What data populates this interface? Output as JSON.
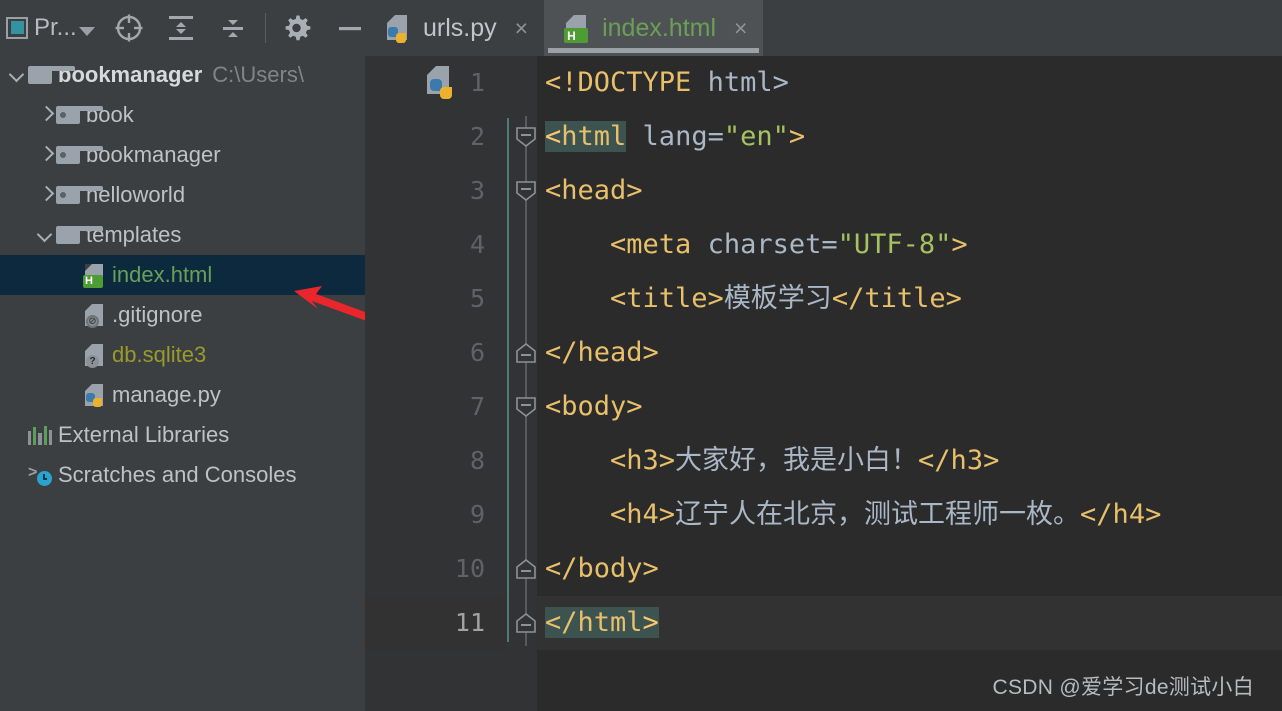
{
  "window": {
    "top_edge_color": "#2e3032"
  },
  "project_panel": {
    "title": "Pr...",
    "title_icon": "project-window-icon",
    "toolbar_buttons": [
      {
        "name": "select-opened-file-icon",
        "tooltip": "Select Opened File"
      },
      {
        "name": "expand-all-icon",
        "tooltip": "Expand All"
      },
      {
        "name": "collapse-all-icon",
        "tooltip": "Collapse All"
      },
      {
        "name": "settings-gear-icon",
        "tooltip": "Settings"
      },
      {
        "name": "hide-panel-icon",
        "tooltip": "Hide"
      }
    ],
    "tree": [
      {
        "label": "bookmanager",
        "path_hint": "C:\\Users\\",
        "icon": "folder-icon",
        "expander": "down",
        "indent": 0,
        "style": "bold",
        "selected": false
      },
      {
        "label": "book",
        "path_hint": "",
        "icon": "folder-module-icon",
        "expander": "right",
        "indent": 1,
        "style": "normal",
        "selected": false
      },
      {
        "label": "bookmanager",
        "path_hint": "",
        "icon": "folder-module-icon",
        "expander": "right",
        "indent": 1,
        "style": "normal",
        "selected": false
      },
      {
        "label": "helloworld",
        "path_hint": "",
        "icon": "folder-module-icon",
        "expander": "right",
        "indent": 1,
        "style": "normal",
        "selected": false
      },
      {
        "label": "templates",
        "path_hint": "",
        "icon": "folder-icon",
        "expander": "down",
        "indent": 1,
        "style": "normal",
        "selected": false
      },
      {
        "label": "index.html",
        "path_hint": "",
        "icon": "html-file-icon",
        "expander": "none",
        "indent": 2,
        "style": "green",
        "selected": true
      },
      {
        "label": ".gitignore",
        "path_hint": "",
        "icon": "gitignore-file-icon",
        "expander": "none",
        "indent": 2,
        "style": "normal",
        "selected": false
      },
      {
        "label": "db.sqlite3",
        "path_hint": "",
        "icon": "unknown-file-icon",
        "expander": "none",
        "indent": 2,
        "style": "olive",
        "selected": false
      },
      {
        "label": "manage.py",
        "path_hint": "",
        "icon": "python-file-icon",
        "expander": "none",
        "indent": 2,
        "style": "normal",
        "selected": false
      },
      {
        "label": "External Libraries",
        "path_hint": "",
        "icon": "external-libraries-icon",
        "expander": "none",
        "indent": 0,
        "style": "normal",
        "selected": false
      },
      {
        "label": "Scratches and Consoles",
        "path_hint": "",
        "icon": "scratches-consoles-icon",
        "expander": "none",
        "indent": 0,
        "style": "normal",
        "selected": false
      }
    ],
    "annotation": {
      "name": "red-arrow-annotation",
      "color": "#e8262b",
      "points_at": "index.html"
    }
  },
  "editor": {
    "tabs": [
      {
        "title": "urls.py",
        "icon": "python-file-icon",
        "active": false,
        "close_glyph": "×"
      },
      {
        "title": "index.html",
        "icon": "html-file-icon",
        "active": true,
        "close_glyph": "×"
      }
    ],
    "current_line": 11,
    "gutter_icon_line1": "python-file-icon",
    "lines": [
      {
        "n": "1",
        "fold": "none",
        "segments": [
          {
            "t": "<!DOCTYPE ",
            "c": "brk"
          },
          {
            "t": "html",
            "c": "txt"
          },
          {
            "t": ">",
            "c": "txt"
          }
        ],
        "indent": 0
      },
      {
        "n": "2",
        "fold": "open",
        "segments": [
          {
            "t": "<html",
            "c": "hl-open"
          },
          {
            "t": " lang=",
            "c": "attr"
          },
          {
            "t": "\"en\"",
            "c": "val"
          },
          {
            "t": ">",
            "c": "brk"
          }
        ],
        "indent": 0
      },
      {
        "n": "3",
        "fold": "open",
        "segments": [
          {
            "t": "<head>",
            "c": "brk"
          }
        ],
        "indent": 0
      },
      {
        "n": "4",
        "fold": "none",
        "segments": [
          {
            "t": "    <meta ",
            "c": "brk"
          },
          {
            "t": "charset=",
            "c": "attr"
          },
          {
            "t": "\"UTF-8\"",
            "c": "val"
          },
          {
            "t": ">",
            "c": "brk"
          }
        ],
        "indent": 1
      },
      {
        "n": "5",
        "fold": "none",
        "segments": [
          {
            "t": "    <title>",
            "c": "brk"
          },
          {
            "t": "模板学习",
            "c": "txt"
          },
          {
            "t": "</title>",
            "c": "brk"
          }
        ],
        "indent": 1
      },
      {
        "n": "6",
        "fold": "close",
        "segments": [
          {
            "t": "</head>",
            "c": "brk"
          }
        ],
        "indent": 0
      },
      {
        "n": "7",
        "fold": "open",
        "segments": [
          {
            "t": "<body>",
            "c": "brk"
          }
        ],
        "indent": 0
      },
      {
        "n": "8",
        "fold": "none",
        "segments": [
          {
            "t": "    <h3>",
            "c": "brk"
          },
          {
            "t": "大家好，我是小白！",
            "c": "txt"
          },
          {
            "t": "</h3>",
            "c": "brk"
          }
        ],
        "indent": 1
      },
      {
        "n": "9",
        "fold": "none",
        "segments": [
          {
            "t": "    <h4>",
            "c": "brk"
          },
          {
            "t": "辽宁人在北京，测试工程师一枚。",
            "c": "txt"
          },
          {
            "t": "</h4>",
            "c": "brk"
          }
        ],
        "indent": 1
      },
      {
        "n": "10",
        "fold": "close",
        "segments": [
          {
            "t": "</body>",
            "c": "brk"
          }
        ],
        "indent": 0
      },
      {
        "n": "11",
        "fold": "close",
        "segments": [
          {
            "t": "</html>",
            "c": "hl-close"
          }
        ],
        "indent": 0
      }
    ],
    "colors": {
      "background": "#2b2b2b",
      "gutter": "#313335",
      "current_line": "#323232",
      "tag": "#e8bf6a",
      "attr_value": "#a5c261",
      "text": "#a9b7c6",
      "match_highlight": "#3c5350",
      "bracket_bright": "#ffe14d",
      "line_number": "#606366",
      "line_number_current": "#a4a3a3"
    }
  },
  "watermark": {
    "text": "CSDN @爱学习de测试小白"
  }
}
